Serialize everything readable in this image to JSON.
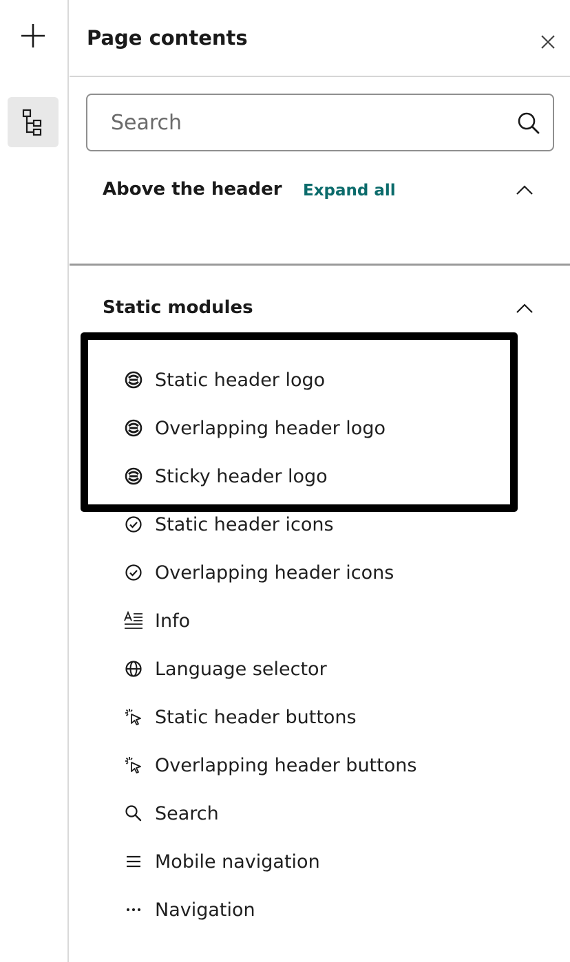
{
  "rail": {
    "add_icon": "plus-icon",
    "tree_icon": "tree-structure-icon"
  },
  "panel": {
    "title": "Page contents",
    "close_icon": "close-icon"
  },
  "search": {
    "placeholder": "Search",
    "icon": "search-icon"
  },
  "sections": {
    "above_header": {
      "title": "Above the header",
      "expand_all_label": "Expand all",
      "state": "expanded"
    },
    "static_modules": {
      "title": "Static modules",
      "state": "expanded"
    }
  },
  "items": [
    {
      "label": "Static header logo",
      "icon": "logo-icon",
      "highlighted": true
    },
    {
      "label": "Overlapping header logo",
      "icon": "logo-icon",
      "highlighted": true
    },
    {
      "label": "Sticky header logo",
      "icon": "logo-icon",
      "highlighted": true
    },
    {
      "label": "Static header icons",
      "icon": "check-circle-icon"
    },
    {
      "label": "Overlapping header icons",
      "icon": "check-circle-icon"
    },
    {
      "label": "Info",
      "icon": "text-format-icon"
    },
    {
      "label": "Language selector",
      "icon": "globe-icon"
    },
    {
      "label": "Static header buttons",
      "icon": "cursor-click-icon"
    },
    {
      "label": "Overlapping header buttons",
      "icon": "cursor-click-icon"
    },
    {
      "label": "Search",
      "icon": "search-icon"
    },
    {
      "label": "Mobile navigation",
      "icon": "hamburger-menu-icon"
    },
    {
      "label": "Navigation",
      "icon": "more-dots-icon"
    }
  ],
  "colors": {
    "accent_link": "#0b6b6b",
    "rail_active_bg": "#e8e8e8",
    "highlight_border": "#000000"
  }
}
